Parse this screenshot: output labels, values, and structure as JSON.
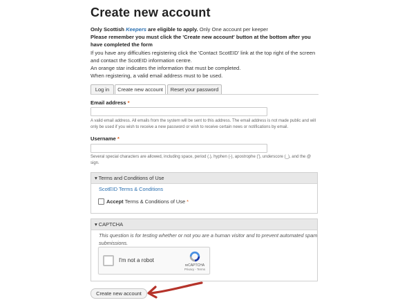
{
  "page_title": "Create new account",
  "intro": {
    "line1_bold_a": "Only Scottish ",
    "line1_keepers": "Keepers",
    "line1_bold_b": " are eligible to apply.",
    "line1_rest": " Only One account per keeper",
    "line2": "Please remember you must click the 'Create new account' button at the bottom after you have completed the form",
    "line3": "If you have any difficulties registering click the 'Contact ScotEID' link at the top right of the screen and contact the ScotEID information centre.",
    "line4": "An orange star indicates the information that must be completed.",
    "line5": "When registering, a valid email address must to be used."
  },
  "tabs": [
    {
      "label": "Log in",
      "active": false
    },
    {
      "label": "Create new account",
      "active": true
    },
    {
      "label": "Reset your password",
      "active": false
    }
  ],
  "email": {
    "label": "Email address",
    "required_marker": "*",
    "value": "",
    "description": "A valid email address. All emails from the system will be sent to this address. The email address is not made public and will only be used if you wish to receive a new password or wish to receive certain news or notifications by email."
  },
  "username": {
    "label": "Username",
    "required_marker": "*",
    "value": "",
    "description": "Several special characters are allowed, including space, period (.), hyphen (-), apostrophe ('), underscore (_), and the @ sign."
  },
  "terms": {
    "legend": "▾ Terms and Conditions of Use",
    "link": "ScotEID Terms & Conditions",
    "accept_bold": "Accept",
    "accept_rest": " Terms & Conditions of Use",
    "required_marker": "*",
    "checked": false
  },
  "captcha": {
    "legend": "▾ CAPTCHA",
    "text": "This question is for testing whether or not you are a human visitor and to prevent automated spam submissions.",
    "recaptcha_label": "I'm not a robot",
    "brand": "reCAPTCHA",
    "brand_links": "Privacy - Terms"
  },
  "submit_label": "Create new account",
  "colors": {
    "required": "#e0621e",
    "link": "#2a6fb0",
    "arrow": "#b5332a"
  }
}
